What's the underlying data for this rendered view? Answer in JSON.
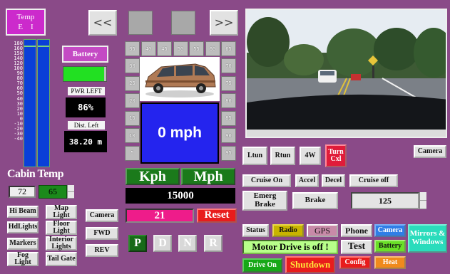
{
  "temp": {
    "title": "Temp",
    "e": "E",
    "i": "I"
  },
  "scale": [
    "180",
    "160",
    "150",
    "140",
    "120",
    "100",
    "90",
    "80",
    "70",
    "60",
    "50",
    "40",
    "30",
    "20",
    "10",
    "0",
    "-10",
    "-20",
    "-30",
    "-40"
  ],
  "cabin": {
    "title": "Cabin Temp",
    "set": "72",
    "actual": "65"
  },
  "battery": {
    "label": "Battery",
    "level": 0.95,
    "pwr_left_label": "PWR LEFT",
    "pwr_left": "86%",
    "dist_left_label": "Dist. Left",
    "dist_left": "38.20 m"
  },
  "nav": {
    "prev": "<<",
    "next": ">>"
  },
  "speed_ticks": {
    "top": [
      "35",
      "40",
      "45",
      "50",
      "55",
      "60",
      "65"
    ],
    "left": [
      "30",
      "25",
      "20",
      "15",
      "10",
      "5"
    ],
    "right": [
      "70",
      "75",
      "80",
      "85",
      "90",
      "95"
    ]
  },
  "speed": "0 mph",
  "units": {
    "kph": "Kph",
    "mph": "Mph"
  },
  "odometer": "15000",
  "trip": {
    "value": "21",
    "reset": "Reset"
  },
  "lights": {
    "hi_beam": "Hi Beam",
    "map_light": "Map Light",
    "hdlights": "HdLights",
    "floor_light": "Floor Light",
    "markers": "Markers",
    "interior_lights": "Interior Lights",
    "fog_light": "Fog Light",
    "tail_gate": "Tail Gate"
  },
  "views": {
    "camera": "Camera",
    "fwd": "FWD",
    "rev": "REV"
  },
  "gears": [
    "P",
    "D",
    "N",
    "R"
  ],
  "camera_btn": "Camera",
  "turn": {
    "ltun": "Ltun",
    "rtun": "Rtun",
    "fourw": "4W",
    "turn_cxl": "Turn Cxl"
  },
  "cruise": {
    "on": "Cruise On",
    "accel": "Accel",
    "decel": "Decel",
    "off": "Cruise off",
    "set_speed": "125"
  },
  "brakes": {
    "emerg": "Emerg Brake",
    "brake": "Brake"
  },
  "bottom": {
    "status": "Status",
    "radio": "Radio",
    "gps": "GPS",
    "phone": "Phone",
    "camera": "Camera",
    "mirrors": "Mirrors & Windows",
    "message": "Motor Drive is off !",
    "test": "Test",
    "battery": "Battery",
    "drive_on": "Drive On",
    "shutdown": "Shutdown",
    "config": "Config",
    "heat": "Heat"
  }
}
